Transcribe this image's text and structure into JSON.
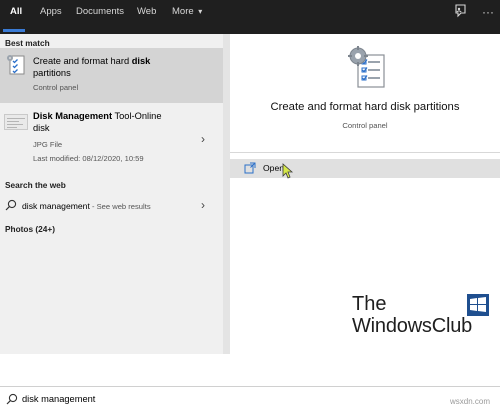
{
  "tabs": [
    {
      "label": "All",
      "active": true
    },
    {
      "label": "Apps",
      "active": false
    },
    {
      "label": "Documents",
      "active": false
    },
    {
      "label": "Web",
      "active": false
    },
    {
      "label": "More",
      "active": false
    }
  ],
  "more_chevron": "▾",
  "best_match": {
    "section_label": "Best match",
    "title_prefix": "Create and format hard ",
    "title_bold": "disk",
    "title_rest": "partitions",
    "subtitle": "Control panel",
    "icon": "control-panel-icon"
  },
  "file_result": {
    "title_bold": "Disk Management",
    "title_rest": " Tool-Online",
    "title_line2": "disk",
    "file_type": "JPG File",
    "last_modified": "Last modified: 08/12/2020, 10:59",
    "icon": "image-thumbnail-icon"
  },
  "web_section": {
    "section_label": "Search the web",
    "query": "disk management",
    "hint": " - See web results"
  },
  "photos_section": {
    "section_label": "Photos (24+)"
  },
  "detail": {
    "title": "Create and format hard disk partitions",
    "subtitle": "Control panel",
    "open_label": "Open"
  },
  "watermark": {
    "line1": "The",
    "line2": "WindowsClub"
  },
  "search": {
    "value": "disk management"
  },
  "site_mark": "wsxdn.com",
  "colors": {
    "accent": "#3a7bd5",
    "topbar": "#1f1f1f",
    "selected": "#d4d4d4"
  }
}
